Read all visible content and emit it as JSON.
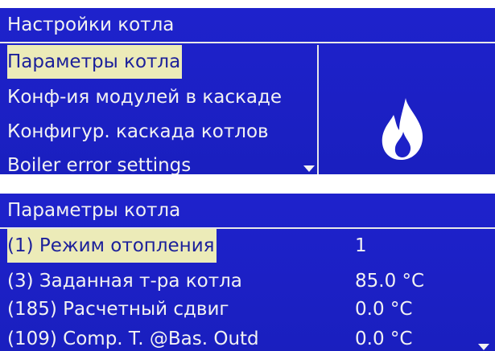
{
  "menu_screen": {
    "title": "Настройки котла",
    "items": [
      {
        "label": "Параметры котла",
        "selected": true
      },
      {
        "label": "Конф-ия модулей в каскаде",
        "selected": false
      },
      {
        "label": "Конфигур. каскада котлов",
        "selected": false
      },
      {
        "label": "Boiler error settings",
        "selected": false
      }
    ],
    "icon": "flame-icon",
    "scroll_indicator": "scroll-down-arrow"
  },
  "params_screen": {
    "title": "Параметры котла",
    "rows": [
      {
        "label": "(1) Режим отопления",
        "value": "1",
        "selected": true
      },
      {
        "label": "(3) Заданная т-ра котла",
        "value": "85.0 °C",
        "selected": false
      },
      {
        "label": "(185) Расчетный сдвиг",
        "value": "0.0 °C",
        "selected": false
      },
      {
        "label": "(109) Comp. T. @Bas. Outd",
        "value": "0.0 °C",
        "selected": false
      }
    ],
    "scroll_indicator": "scroll-down-arrow"
  },
  "colors": {
    "screen_bg": "#1d21c8",
    "text": "#f2f2f2",
    "highlight_bg": "#ecebb8",
    "highlight_text": "#1b1f9a"
  }
}
